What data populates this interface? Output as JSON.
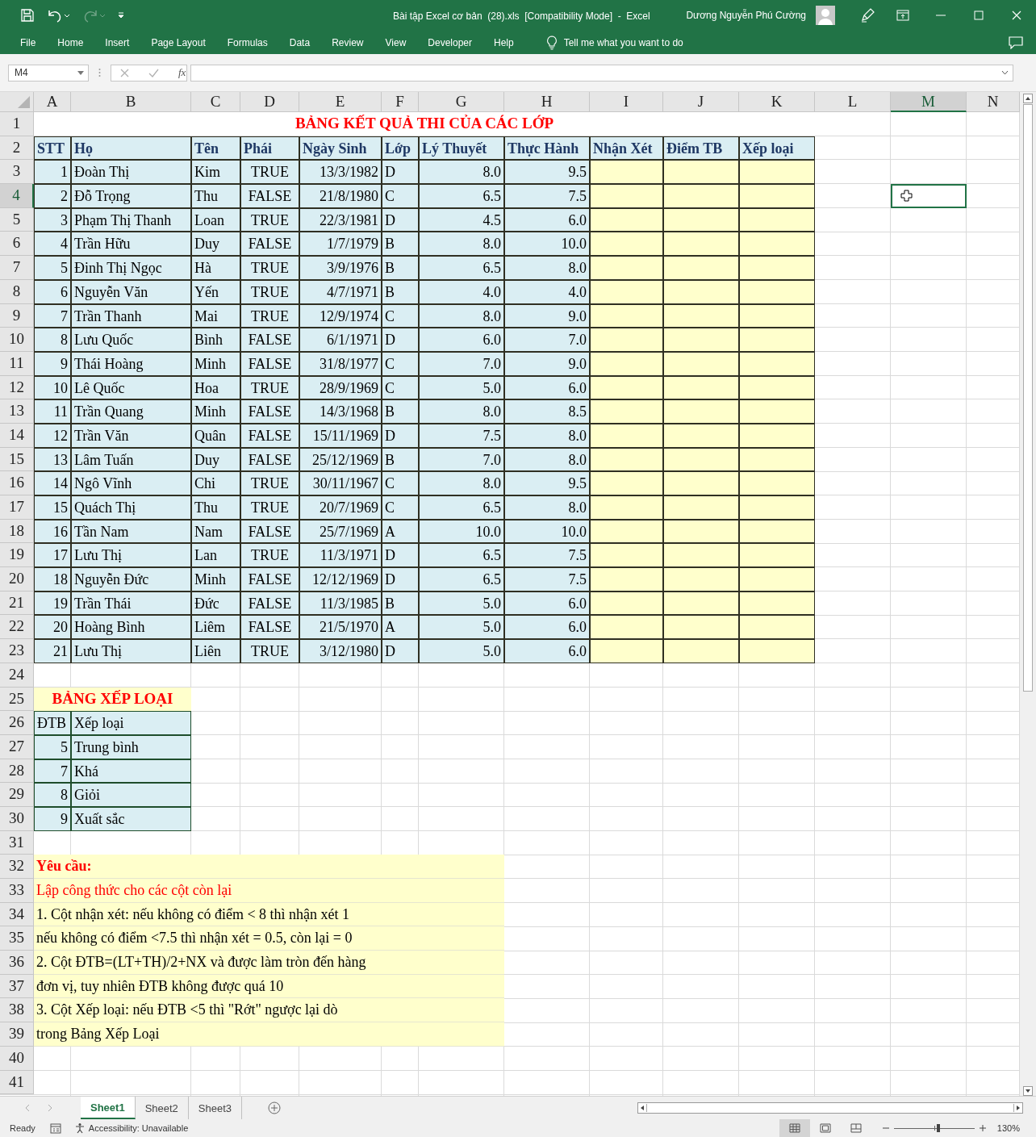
{
  "quick_access": [
    {
      "kind": "save",
      "disabled": false
    },
    {
      "kind": "undo",
      "disabled": false
    },
    {
      "kind": "redo",
      "disabled": true
    },
    {
      "kind": "customize",
      "disabled": false
    }
  ],
  "window": {
    "title": "Bài tập Excel cơ bản  (28).xls  [Compatibility Mode]  -  Excel",
    "user": "Dương Nguyễn Phú Cường"
  },
  "ribbon_tabs": [
    "File",
    "Home",
    "Insert",
    "Page Layout",
    "Formulas",
    "Data",
    "Review",
    "View",
    "Developer",
    "Help"
  ],
  "tell_me": {
    "placeholder": "Tell me what you want to do"
  },
  "formula_bar": {
    "name_box": "M4",
    "function_label": "fx"
  },
  "columns": [
    {
      "label": "A",
      "selected": false
    },
    {
      "label": "B",
      "selected": false
    },
    {
      "label": "C",
      "selected": false
    },
    {
      "label": "D",
      "selected": false
    },
    {
      "label": "E",
      "selected": false
    },
    {
      "label": "F",
      "selected": false
    },
    {
      "label": "G",
      "selected": false
    },
    {
      "label": "H",
      "selected": false
    },
    {
      "label": "I",
      "selected": false
    },
    {
      "label": "J",
      "selected": false
    },
    {
      "label": "K",
      "selected": false
    },
    {
      "label": "L",
      "selected": false
    },
    {
      "label": "M",
      "selected": true
    },
    {
      "label": "N",
      "selected": false
    }
  ],
  "row_headers": [
    {
      "label": "1",
      "selected": false
    },
    {
      "label": "2",
      "selected": false
    },
    {
      "label": "3",
      "selected": false
    },
    {
      "label": "4",
      "selected": true
    },
    {
      "label": "5",
      "selected": false
    },
    {
      "label": "6",
      "selected": false
    },
    {
      "label": "7",
      "selected": false
    },
    {
      "label": "8",
      "selected": false
    },
    {
      "label": "9",
      "selected": false
    },
    {
      "label": "10",
      "selected": false
    },
    {
      "label": "11",
      "selected": false
    },
    {
      "label": "12",
      "selected": false
    },
    {
      "label": "13",
      "selected": false
    },
    {
      "label": "14",
      "selected": false
    },
    {
      "label": "15",
      "selected": false
    },
    {
      "label": "16",
      "selected": false
    },
    {
      "label": "17",
      "selected": false
    },
    {
      "label": "18",
      "selected": false
    },
    {
      "label": "19",
      "selected": false
    },
    {
      "label": "20",
      "selected": false
    },
    {
      "label": "21",
      "selected": false
    },
    {
      "label": "22",
      "selected": false
    },
    {
      "label": "23",
      "selected": false
    },
    {
      "label": "24",
      "selected": false
    },
    {
      "label": "25",
      "selected": false
    },
    {
      "label": "26",
      "selected": false
    },
    {
      "label": "27",
      "selected": false
    },
    {
      "label": "28",
      "selected": false
    },
    {
      "label": "29",
      "selected": false
    },
    {
      "label": "30",
      "selected": false
    },
    {
      "label": "31",
      "selected": false
    },
    {
      "label": "32",
      "selected": false
    },
    {
      "label": "33",
      "selected": false
    },
    {
      "label": "34",
      "selected": false
    },
    {
      "label": "35",
      "selected": false
    },
    {
      "label": "36",
      "selected": false
    },
    {
      "label": "37",
      "selected": false
    },
    {
      "label": "38",
      "selected": false
    },
    {
      "label": "39",
      "selected": false
    },
    {
      "label": "40",
      "selected": false
    },
    {
      "label": "41",
      "selected": false
    }
  ],
  "results_table": {
    "title": "BẢNG KẾT QUẢ THI CỦA CÁC LỚP",
    "headers": [
      "STT",
      "Họ",
      "Tên",
      "Phái",
      "Ngày Sinh",
      "Lớp",
      "Lý Thuyết",
      "Thực Hành",
      "Nhận Xét",
      "Điểm TB",
      "Xếp loại"
    ],
    "rows": [
      [
        "1",
        "Đoàn Thị",
        "Kim",
        "TRUE",
        "13/3/1982",
        "D",
        "8.0",
        "9.5"
      ],
      [
        "2",
        "Đỗ Trọng",
        "Thu",
        "FALSE",
        "21/8/1980",
        "C",
        "6.5",
        "7.5"
      ],
      [
        "3",
        "Phạm Thị Thanh",
        "Loan",
        "TRUE",
        "22/3/1981",
        "D",
        "4.5",
        "6.0"
      ],
      [
        "4",
        "Trần Hữu",
        "Duy",
        "FALSE",
        "1/7/1979",
        "B",
        "8.0",
        "10.0"
      ],
      [
        "5",
        "Đinh Thị Ngọc",
        "Hà",
        "TRUE",
        "3/9/1976",
        "B",
        "6.5",
        "8.0"
      ],
      [
        "6",
        "Nguyễn Văn",
        "Yến",
        "TRUE",
        "4/7/1971",
        "B",
        "4.0",
        "4.0"
      ],
      [
        "7",
        "Trần Thanh",
        "Mai",
        "TRUE",
        "12/9/1974",
        "C",
        "8.0",
        "9.0"
      ],
      [
        "8",
        "Lưu Quốc",
        "Bình",
        "FALSE",
        "6/1/1971",
        "D",
        "6.0",
        "7.0"
      ],
      [
        "9",
        "Thái Hoàng",
        "Minh",
        "FALSE",
        "31/8/1977",
        "C",
        "7.0",
        "9.0"
      ],
      [
        "10",
        "Lê Quốc",
        "Hoa",
        "TRUE",
        "28/9/1969",
        "C",
        "5.0",
        "6.0"
      ],
      [
        "11",
        "Trần Quang",
        "Minh",
        "FALSE",
        "14/3/1968",
        "B",
        "8.0",
        "8.5"
      ],
      [
        "12",
        "Trần Văn",
        "Quân",
        "FALSE",
        "15/11/1969",
        "D",
        "7.5",
        "8.0"
      ],
      [
        "13",
        "Lâm Tuấn",
        "Duy",
        "FALSE",
        "25/12/1969",
        "B",
        "7.0",
        "8.0"
      ],
      [
        "14",
        "Ngô Vĩnh",
        "Chi",
        "TRUE",
        "30/11/1967",
        "C",
        "8.0",
        "9.5"
      ],
      [
        "15",
        "Quách Thị",
        "Thu",
        "TRUE",
        "20/7/1969",
        "C",
        "6.5",
        "8.0"
      ],
      [
        "16",
        "Tần Nam",
        "Nam",
        "FALSE",
        "25/7/1969",
        "A",
        "10.0",
        "10.0"
      ],
      [
        "17",
        "Lưu Thị",
        "Lan",
        "TRUE",
        "11/3/1971",
        "D",
        "6.5",
        "7.5"
      ],
      [
        "18",
        "Nguyễn Đức",
        "Minh",
        "FALSE",
        "12/12/1969",
        "D",
        "6.5",
        "7.5"
      ],
      [
        "19",
        "Trần Thái",
        "Đức",
        "FALSE",
        "11/3/1985",
        "B",
        "5.0",
        "6.0"
      ],
      [
        "20",
        "Hoàng Bình",
        "Liêm",
        "FALSE",
        "21/5/1970",
        "A",
        "5.0",
        "6.0"
      ],
      [
        "21",
        "Lưu Thị",
        "Liên",
        "TRUE",
        "3/12/1980",
        "D",
        "5.0",
        "6.0"
      ]
    ]
  },
  "ranking_table": {
    "title": "BẢNG XẾP LOẠI",
    "headers": [
      "ĐTB",
      "Xếp loại"
    ],
    "rows": [
      [
        "5",
        "Trung bình"
      ],
      [
        "7",
        "Khá"
      ],
      [
        "8",
        "Giỏi"
      ],
      [
        "9",
        "Xuất sắc"
      ]
    ]
  },
  "requirements": [
    {
      "kind": "heading",
      "text": "Yêu cầu:"
    },
    {
      "kind": "note",
      "text": "Lập công thức  cho các cột còn lại"
    },
    {
      "kind": "text",
      "text": "1. Cột nhận xét: nếu không có điểm < 8 thì nhận xét 1"
    },
    {
      "kind": "text",
      "text": "nếu không có điểm <7.5 thì nhận xét = 0.5, còn lại = 0"
    },
    {
      "kind": "text",
      "text": "2. Cột ĐTB=(LT+TH)/2+NX và được làm tròn đến hàng"
    },
    {
      "kind": "text",
      "text": "đơn vị, tuy nhiên ĐTB không được quá  10"
    },
    {
      "kind": "text",
      "text": "3. Cột Xếp loại: nếu ĐTB <5 thì \"Rớt\" ngược lại dò"
    },
    {
      "kind": "text",
      "text": "trong Bảng Xếp Loại"
    }
  ],
  "sheet_tabs": [
    {
      "label": "Sheet1",
      "selected": true
    },
    {
      "label": "Sheet2",
      "selected": false
    },
    {
      "label": "Sheet3",
      "selected": false
    }
  ],
  "status_bar": {
    "mode": "Ready",
    "accessibility": "Accessibility: Unavailable",
    "views": [
      {
        "kind": "normal",
        "selected": true
      },
      {
        "kind": "page_layout",
        "selected": false
      },
      {
        "kind": "page_break",
        "selected": false
      }
    ],
    "zoom": {
      "level": 0.55,
      "label": "130%"
    }
  }
}
